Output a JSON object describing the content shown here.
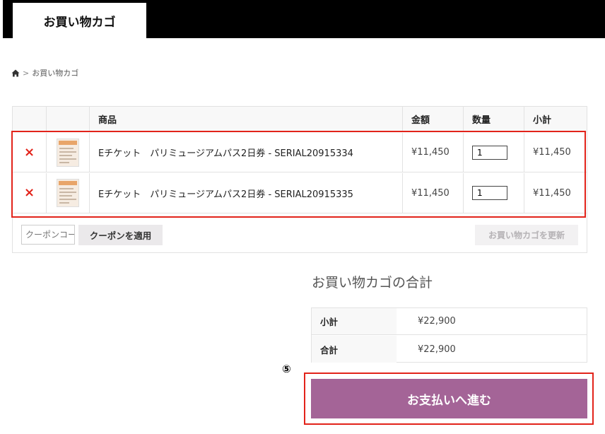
{
  "header": {
    "tab_label": "お買い物カゴ"
  },
  "breadcrumb": {
    "home_icon": "home-icon",
    "separator": ">",
    "current": "お買い物カゴ"
  },
  "cart": {
    "columns": [
      "",
      "",
      "商品",
      "金額",
      "数量",
      "小計"
    ],
    "items": [
      {
        "remove": "×",
        "name": "Eチケット　パリミュージアムパス2日券 - SERIAL20915334",
        "price": "¥11,450",
        "quantity": "1",
        "subtotal": "¥11,450"
      },
      {
        "remove": "×",
        "name": "Eチケット　パリミュージアムパス2日券 - SERIAL20915335",
        "price": "¥11,450",
        "quantity": "1",
        "subtotal": "¥11,450"
      }
    ],
    "coupon_placeholder": "クーポンコード",
    "apply_coupon_label": "クーポンを適用",
    "update_cart_label": "お買い物カゴを更新"
  },
  "totals": {
    "title": "お買い物カゴの合計",
    "rows": [
      {
        "label": "小計",
        "value": "¥22,900"
      },
      {
        "label": "合計",
        "value": "¥22,900"
      }
    ]
  },
  "checkout": {
    "step_marker": "⑤",
    "label": "お支払いへ進む"
  },
  "colors": {
    "remove": "#e2231a",
    "checkout": "#a46497",
    "highlight": "#e2231a"
  }
}
